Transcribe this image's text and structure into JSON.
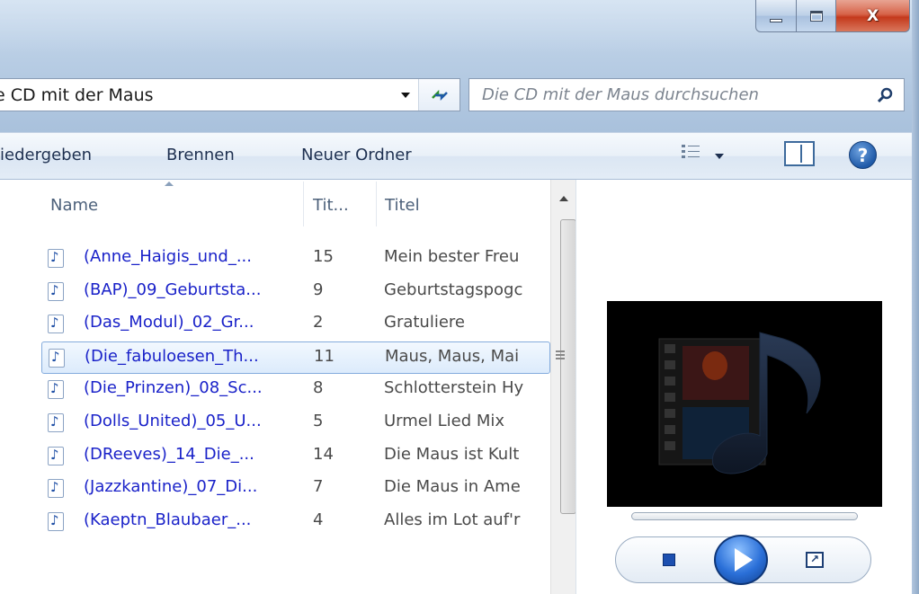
{
  "window": {
    "controls": {
      "minimize": "minimize",
      "maximize": "maximize",
      "close": "X"
    }
  },
  "address": {
    "path": "e CD mit der Maus",
    "search_placeholder": "Die CD mit der Maus durchsuchen"
  },
  "toolbar": {
    "play": "iedergeben",
    "burn": "Brennen",
    "new_folder": "Neuer Ordner",
    "help": "?"
  },
  "columns": {
    "name": "Name",
    "track": "Tit...",
    "title": "Titel",
    "sorted_by": "Name"
  },
  "files": [
    {
      "name": "(Anne_Haigis_und_...",
      "track": "15",
      "title": "Mein bester Freu",
      "selected": false
    },
    {
      "name": "(BAP)_09_Geburtsta...",
      "track": "9",
      "title": "Geburtstagspogc",
      "selected": false
    },
    {
      "name": "(Das_Modul)_02_Gr...",
      "track": "2",
      "title": "Gratuliere",
      "selected": false
    },
    {
      "name": "(Die_fabuloesen_Th...",
      "track": "11",
      "title": "Maus, Maus, Mai",
      "selected": true
    },
    {
      "name": "(Die_Prinzen)_08_Sc...",
      "track": "8",
      "title": "Schlotterstein Hy",
      "selected": false
    },
    {
      "name": "(Dolls_United)_05_U...",
      "track": "5",
      "title": "Urmel Lied Mix",
      "selected": false
    },
    {
      "name": "(DReeves)_14_Die_...",
      "track": "14",
      "title": "Die Maus ist Kult",
      "selected": false
    },
    {
      "name": "(Jazzkantine)_07_Di...",
      "track": "7",
      "title": "Die Maus in Ame",
      "selected": false
    },
    {
      "name": "(Kaeptn_Blaubaer_...",
      "track": "4",
      "title": "Alles im Lot auf'r",
      "selected": false
    }
  ],
  "preview": {
    "icons": [
      "media-file-icon",
      "stop-icon",
      "play-icon",
      "switch-to-player-icon"
    ]
  }
}
